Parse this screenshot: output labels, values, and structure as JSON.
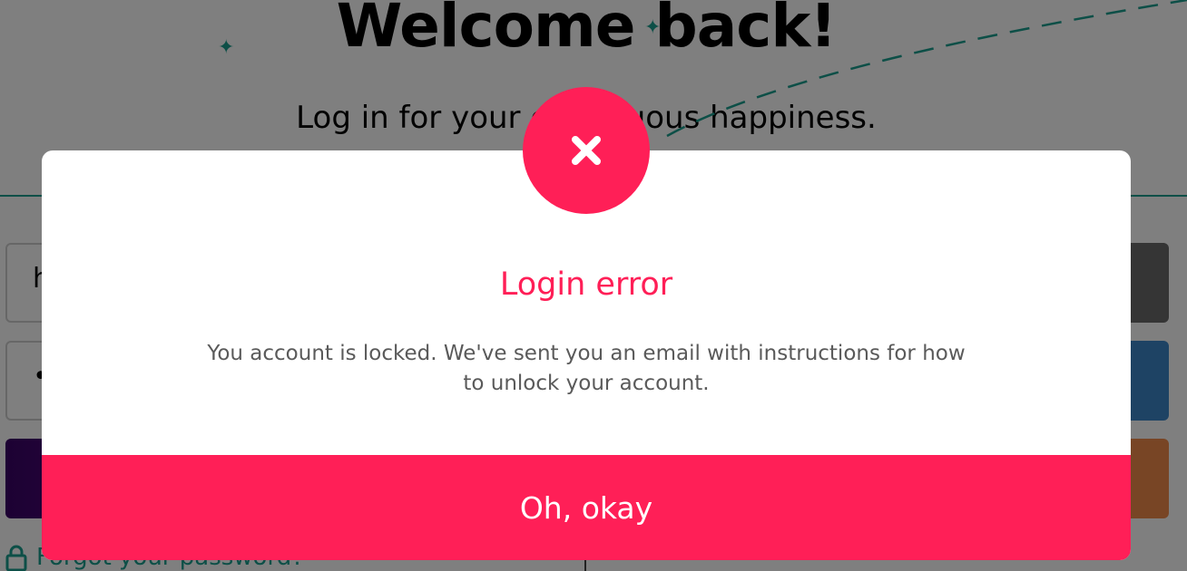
{
  "page": {
    "title": "Welcome back!",
    "subtitle": "Log in for your continuous happiness.",
    "email_value": "h",
    "password_value": "•",
    "forgot_password": "Forgot your password?"
  },
  "modal": {
    "heading": "Login error",
    "message": "You account is locked. We've sent you an email with instructions for how to unlock your account.",
    "action_label": "Oh, okay",
    "icon": "close-icon"
  },
  "colors": {
    "accent": "#ff1f57",
    "teal": "#1a9e8f",
    "overlay": "rgba(0,0,0,0.5)"
  }
}
